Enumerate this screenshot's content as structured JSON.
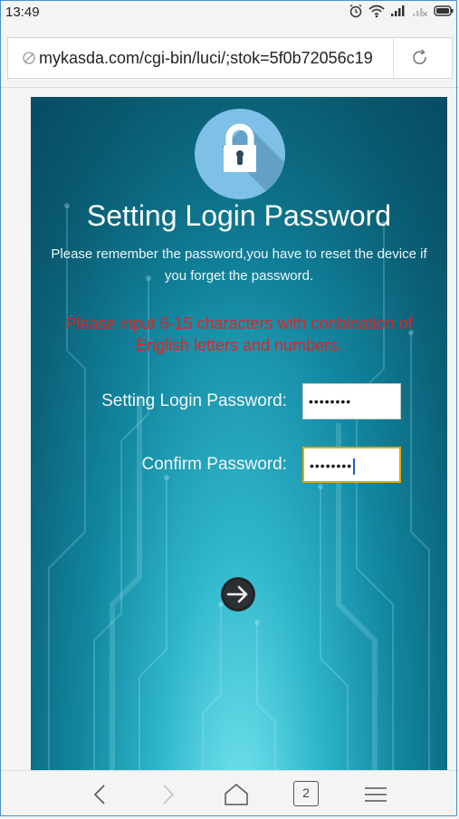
{
  "status_bar": {
    "time": "13:49",
    "icons": [
      "alarm-icon",
      "wifi-icon",
      "signal-icon",
      "no-signal-icon",
      "battery-icon"
    ]
  },
  "browser": {
    "url": "mykasda.com/cgi-bin/luci/;stok=5f0b72056c19",
    "link_icon": "link-icon",
    "reload_icon": "reload-icon"
  },
  "page": {
    "title": "Setting Login Password",
    "warning": "Please remember the password,you have to reset the device if you forget the password.",
    "rule": "Please input 6-15 characters with conbination of English letters and numbers.",
    "password_label": "Setting Login Password:",
    "password_value": "••••••••",
    "confirm_label": "Confirm Password:",
    "confirm_value": "••••••••",
    "next_icon": "arrow-right-circle-icon"
  },
  "bottom_nav": {
    "tab_count": "2",
    "icons": [
      "back-icon",
      "forward-icon",
      "home-icon",
      "tabs-icon",
      "menu-icon"
    ]
  },
  "colors": {
    "accent_blue": "#1a5fd6",
    "rule_red": "#e02424",
    "focus_border": "#e0a800",
    "panel_teal": "#12869f"
  }
}
